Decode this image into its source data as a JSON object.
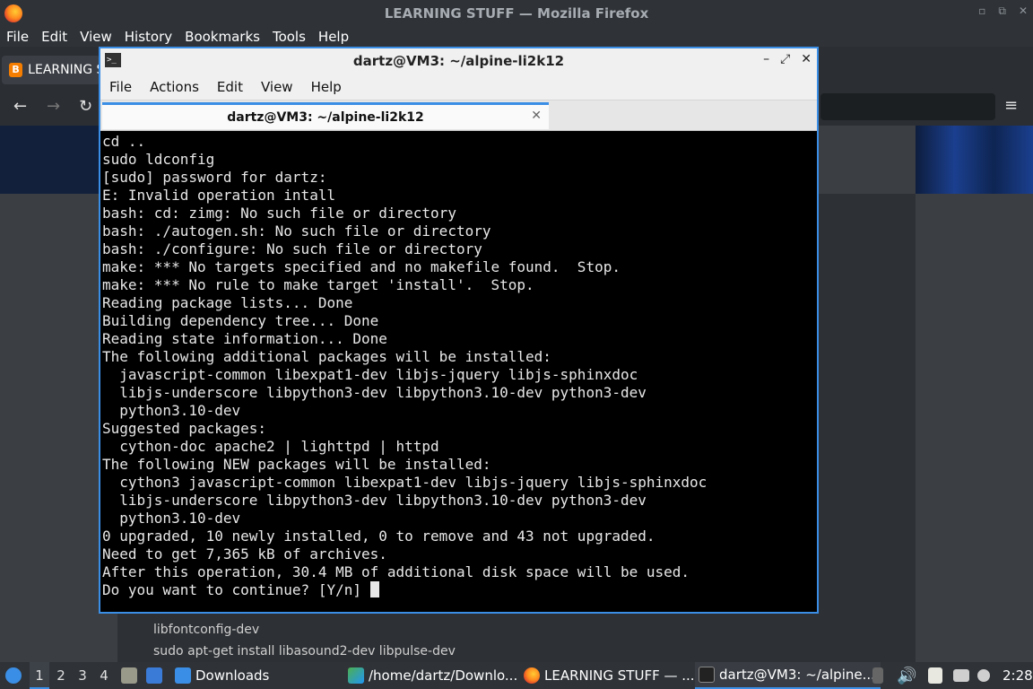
{
  "firefox": {
    "window_title": "LEARNING STUFF — Mozilla Firefox",
    "menu": [
      "File",
      "Edit",
      "View",
      "History",
      "Bookmarks",
      "Tools",
      "Help"
    ],
    "tab_title": "LEARNING S",
    "page_lines": [
      "libfontconfig-dev",
      "sudo apt-get install libasound2-dev libpulse-dev"
    ]
  },
  "terminal": {
    "title": "dartz@VM3: ~/alpine-li2k12",
    "menu": [
      "File",
      "Actions",
      "Edit",
      "View",
      "Help"
    ],
    "tab_label": "dartz@VM3: ~/alpine-li2k12",
    "lines": [
      "cd ..",
      "sudo ldconfig",
      "[sudo] password for dartz:",
      "E: Invalid operation intall",
      "bash: cd: zimg: No such file or directory",
      "bash: ./autogen.sh: No such file or directory",
      "bash: ./configure: No such file or directory",
      "make: *** No targets specified and no makefile found.  Stop.",
      "make: *** No rule to make target 'install'.  Stop.",
      "Reading package lists... Done",
      "Building dependency tree... Done",
      "Reading state information... Done",
      "The following additional packages will be installed:",
      "  javascript-common libexpat1-dev libjs-jquery libjs-sphinxdoc",
      "  libjs-underscore libpython3-dev libpython3.10-dev python3-dev",
      "  python3.10-dev",
      "Suggested packages:",
      "  cython-doc apache2 | lighttpd | httpd",
      "The following NEW packages will be installed:",
      "  cython3 javascript-common libexpat1-dev libjs-jquery libjs-sphinxdoc",
      "  libjs-underscore libpython3-dev libpython3.10-dev python3-dev",
      "  python3.10-dev",
      "0 upgraded, 10 newly installed, 0 to remove and 43 not upgraded.",
      "Need to get 7,365 kB of archives.",
      "After this operation, 30.4 MB of additional disk space will be used."
    ],
    "prompt_line": "Do you want to continue? [Y/n] "
  },
  "taskbar": {
    "workspaces": [
      "1",
      "2",
      "3",
      "4"
    ],
    "downloads_label": "Downloads",
    "tasks": [
      "/home/dartz/Downlo...",
      "LEARNING STUFF — ...",
      "dartz@VM3: ~/alpine..."
    ],
    "clock": "2:28"
  },
  "colors": {
    "accent": "#3b8ee5",
    "terminal_bg": "#000000",
    "panel_bg": "#2f3338"
  }
}
